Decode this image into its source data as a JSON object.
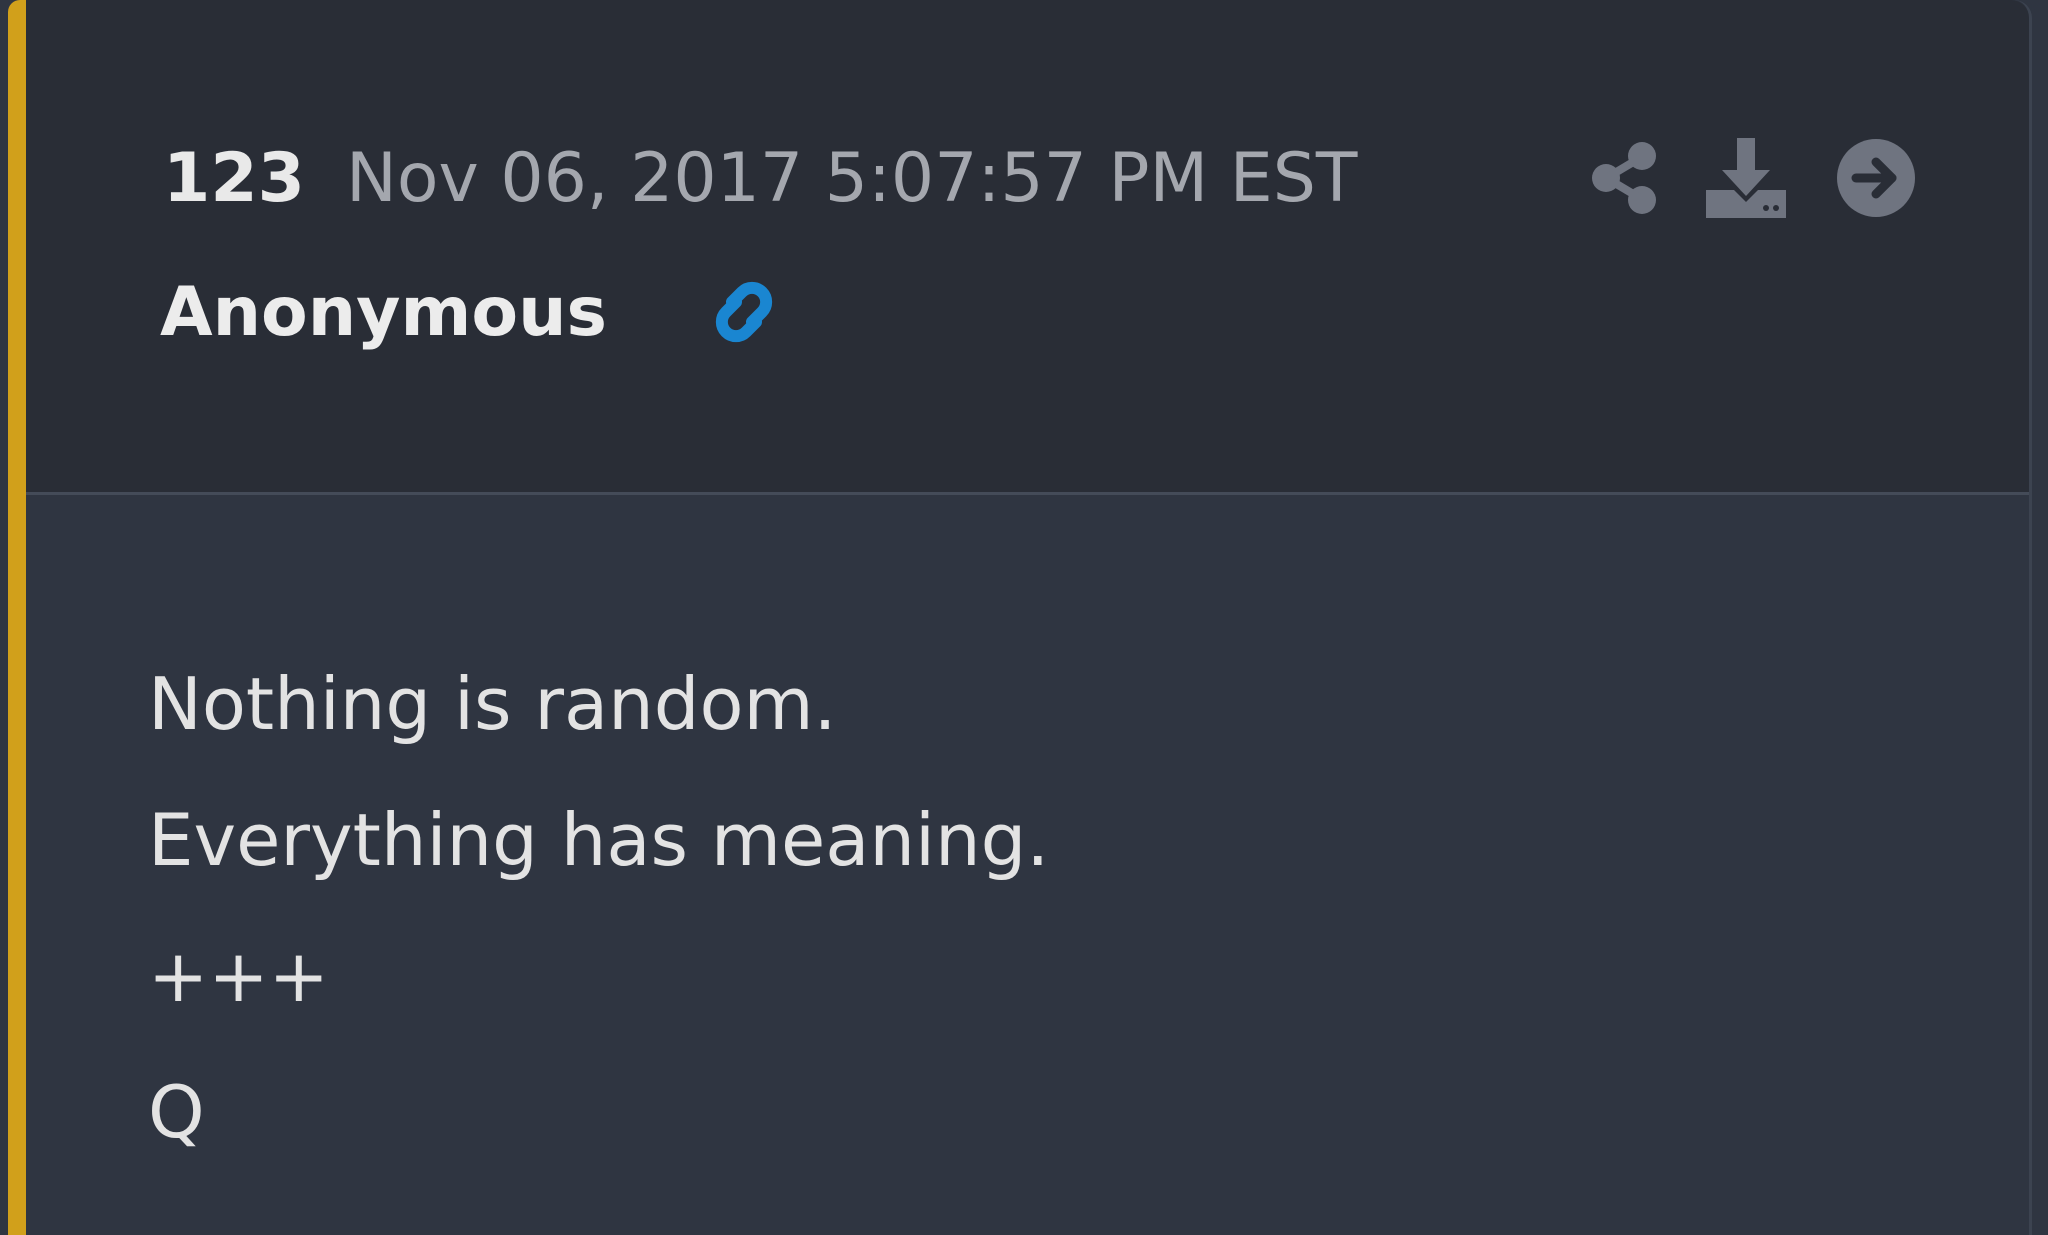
{
  "post": {
    "number": "123",
    "timestamp": "Nov 06, 2017 5:07:57 PM EST",
    "author": "Anonymous",
    "accent_color": "#d1a01b",
    "link_color": "#1a86d1",
    "icons": {
      "author_link": "link-icon",
      "share": "share-icon",
      "download": "download-icon",
      "next": "arrow-right-circle-icon"
    },
    "lines": [
      "Nothing is random.",
      "Everything has meaning.",
      "+++",
      "Q"
    ]
  }
}
